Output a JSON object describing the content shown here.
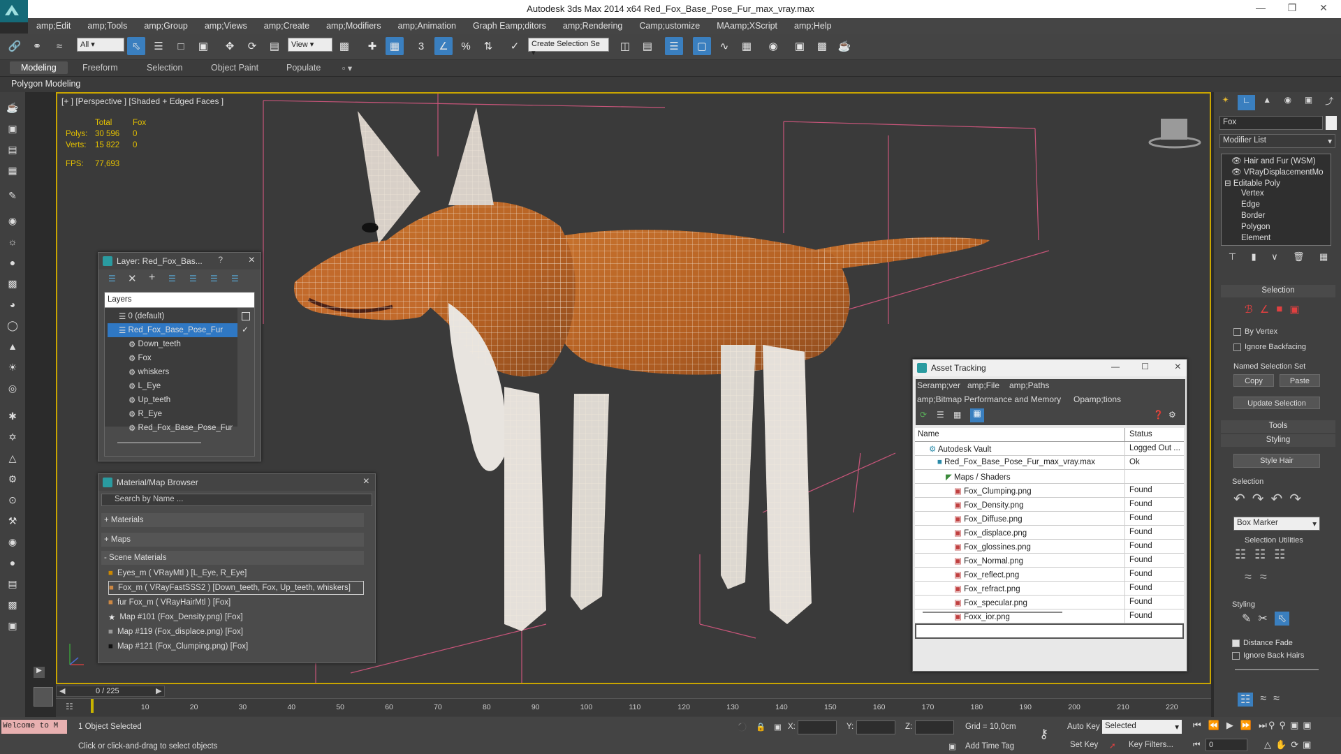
{
  "app": {
    "title": "Autodesk 3ds Max  2014 x64     Red_Fox_Base_Pose_Fur_max_vray.max"
  },
  "menu": [
    "amp;Edit",
    "amp;Tools",
    "amp;Group",
    "amp;Views",
    "amp;Create",
    "amp;Modifiers",
    "amp;Animation",
    "Graph Eamp;ditors",
    "amp;Rendering",
    "Camp;ustomize",
    "MAamp;XScript",
    "amp;Help"
  ],
  "toolbar": {
    "filter_value": "All",
    "ref_coord_value": "View",
    "selection_set_placeholder": "Create Selection Se"
  },
  "ribbon": {
    "tabs": [
      "Modeling",
      "Freeform",
      "Selection",
      "Object Paint",
      "Populate"
    ],
    "subtitle": "Polygon Modeling"
  },
  "viewport": {
    "label": "[+ ] [Perspective ] [Shaded + Edged Faces ]",
    "stats_header_total": "Total",
    "stats_header_obj": "Fox",
    "polys_label": "Polys:",
    "polys_total": "30 596",
    "polys_obj": "0",
    "verts_label": "Verts:",
    "verts_total": "15 822",
    "verts_obj": "0",
    "fps_label": "FPS:",
    "fps_value": "77,693"
  },
  "layer_window": {
    "title": "Layer: Red_Fox_Bas...",
    "help": "?",
    "header": "Layers",
    "items": [
      "0 (default)",
      "Red_Fox_Base_Pose_Fur",
      "Down_teeth",
      "Fox",
      "whiskers",
      "L_Eye",
      "Up_teeth",
      "R_Eye",
      "Red_Fox_Base_Pose_Fur"
    ]
  },
  "material_browser": {
    "title": "Material/Map Browser",
    "search_placeholder": "Search by Name ...",
    "groups": [
      "+ Materials",
      "+ Maps",
      "- Scene Materials"
    ],
    "items": [
      "Eyes_m  ( VRayMtl ) [L_Eye, R_Eye]",
      "Fox_m  ( VRayFastSSS2 ) [Down_teeth, Fox, Up_teeth, whiskers]",
      "fur Fox_m  ( VRayHairMtl ) [Fox]",
      "Map #101 (Fox_Density.png) [Fox]",
      "Map #119 (Fox_displace.png) [Fox]",
      "Map #121 (Fox_Clumping.png) [Fox]"
    ]
  },
  "asset_tracking": {
    "title": "Asset Tracking",
    "menu1": [
      "Seramp;ver",
      "amp;File",
      "amp;Paths"
    ],
    "menu2": [
      "amp;Bitmap Performance and Memory",
      "Opamp;tions"
    ],
    "col_name": "Name",
    "col_status": "Status",
    "rows": [
      {
        "name": "Autodesk Vault",
        "status": "Logged Out ...",
        "indent": 0
      },
      {
        "name": "Red_Fox_Base_Pose_Fur_max_vray.max",
        "status": "Ok",
        "indent": 1
      },
      {
        "name": "Maps / Shaders",
        "status": "",
        "indent": 2
      },
      {
        "name": "Fox_Clumping.png",
        "status": "Found",
        "indent": 3
      },
      {
        "name": "Fox_Density.png",
        "status": "Found",
        "indent": 3
      },
      {
        "name": "Fox_Diffuse.png",
        "status": "Found",
        "indent": 3
      },
      {
        "name": "Fox_displace.png",
        "status": "Found",
        "indent": 3
      },
      {
        "name": "Fox_glossines.png",
        "status": "Found",
        "indent": 3
      },
      {
        "name": "Fox_Normal.png",
        "status": "Found",
        "indent": 3
      },
      {
        "name": "Fox_reflect.png",
        "status": "Found",
        "indent": 3
      },
      {
        "name": "Fox_refract.png",
        "status": "Found",
        "indent": 3
      },
      {
        "name": "Fox_specular.png",
        "status": "Found",
        "indent": 3
      },
      {
        "name": "Foxx_ior.png",
        "status": "Found",
        "indent": 3
      }
    ]
  },
  "right_panel": {
    "object_name": "Fox",
    "modifier_list": "Modifier List",
    "stack": [
      "Hair and Fur (WSM)",
      "VRayDisplacementMo",
      "Editable Poly",
      "Vertex",
      "Edge",
      "Border",
      "Polygon",
      "Element"
    ],
    "selection_rollout": "Selection",
    "by_vertex": "By Vertex",
    "ignore_backfacing": "Ignore Backfacing",
    "named_selection_set": "Named Selection Set",
    "copy": "Copy",
    "paste": "Paste",
    "update_selection": "Update Selection",
    "tools_rollout": "Tools",
    "styling_rollout": "Styling",
    "style_hair": "Style Hair",
    "selection_label": "Selection",
    "box_marker": "Box Marker",
    "selection_utilities": "Selection Utilities",
    "styling_label": "Styling",
    "distance_fade": "Distance Fade",
    "ignore_back_hairs": "Ignore Back Hairs"
  },
  "timeline": {
    "frame_counter": "0 / 225",
    "ticks": [
      "0",
      "10",
      "20",
      "30",
      "40",
      "50",
      "60",
      "70",
      "80",
      "90",
      "100",
      "110",
      "120",
      "130",
      "140",
      "150",
      "160",
      "170",
      "180",
      "190",
      "200",
      "210",
      "220"
    ]
  },
  "status": {
    "welcome": "Welcome to M",
    "selected_count": "1 Object Selected",
    "prompt": "Click or click-and-drag to select objects",
    "x_label": "X:",
    "y_label": "Y:",
    "z_label": "Z:",
    "grid": "Grid = 10,0cm",
    "add_time_tag": "Add Time Tag",
    "auto_key": "Auto Key",
    "set_key": "Set Key",
    "key_mode": "Selected",
    "key_filters": "Key Filters...",
    "frame": "0"
  }
}
